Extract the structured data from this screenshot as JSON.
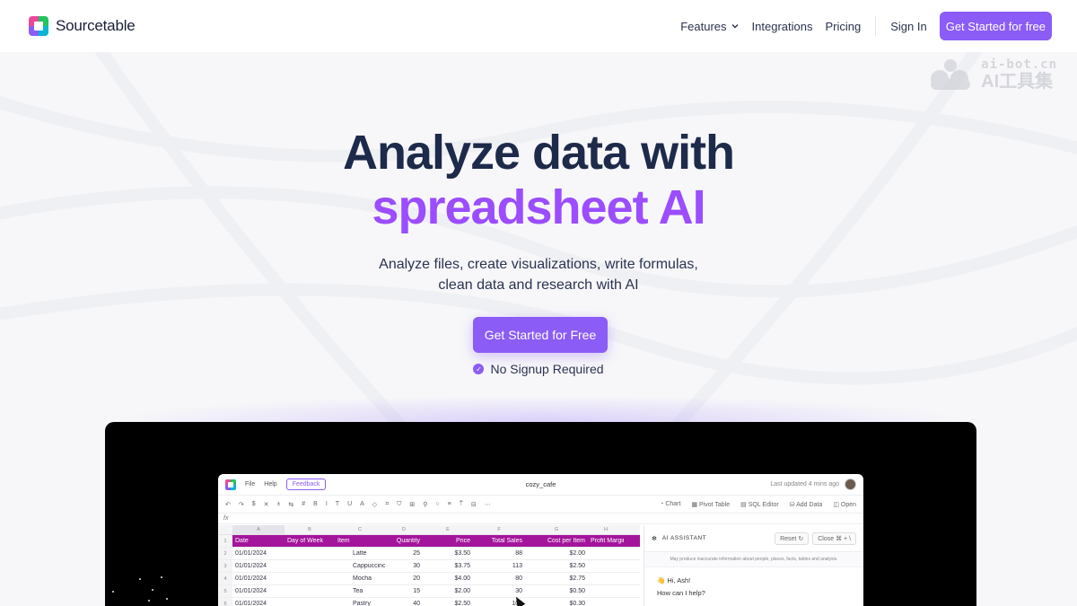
{
  "nav": {
    "brand": "Sourcetable",
    "links": [
      "Features",
      "Integrations",
      "Pricing"
    ],
    "sign_in": "Sign In",
    "cta": "Get Started for free",
    "features_icon": "chevron-down-icon"
  },
  "watermark": {
    "line1": "ai-bot.cn",
    "line2": "AI工具集"
  },
  "hero": {
    "title_line1": "Analyze data with",
    "title_line2": "spreadsheet AI",
    "subtitle_line1": "Analyze files, create visualizations, write formulas,",
    "subtitle_line2": "clean data and research with AI",
    "cta": "Get Started for Free",
    "note": "No Signup Required"
  },
  "colors": {
    "accent": "#8b5cf6",
    "title": "#1d2a4a",
    "gradient_from": "#9b4dff",
    "gradient_to": "#7c3aed",
    "header_row": "#a3159b"
  },
  "app": {
    "menu": [
      "File",
      "Help"
    ],
    "feedback": "Feedback",
    "title": "cozy_cafe",
    "updated": "Last updated 4 mins ago",
    "toolbar_right": [
      "Chart",
      "Pivot Table",
      "SQL Editor",
      "Add Data",
      "Open"
    ],
    "fx": "fx",
    "columns": [
      "A",
      "B",
      "C",
      "D",
      "E",
      "F",
      "G",
      "H"
    ],
    "header": [
      "Date",
      "Day of Week",
      "Item",
      "Quantity",
      "Price",
      "Total Sales",
      "Cost per Item",
      "Profit Margin"
    ],
    "rows": [
      [
        "01/01/2024",
        "",
        "Latte",
        "25",
        "$3.50",
        "88",
        "$2.00",
        ""
      ],
      [
        "01/01/2024",
        "",
        "Cappuccino",
        "30",
        "$3.75",
        "113",
        "$2.50",
        ""
      ],
      [
        "01/01/2024",
        "",
        "Mocha",
        "20",
        "$4.00",
        "80",
        "$2.75",
        ""
      ],
      [
        "01/01/2024",
        "",
        "Tea",
        "15",
        "$2.00",
        "30",
        "$0.50",
        ""
      ],
      [
        "01/01/2024",
        "",
        "Pastry",
        "40",
        "$2.50",
        "100",
        "$0.30",
        ""
      ]
    ],
    "row_numbers": [
      "1",
      "2",
      "3",
      "4",
      "5",
      "6"
    ],
    "ai": {
      "title": "AI ASSISTANT",
      "reset": "Reset",
      "close": "Close",
      "shortcut": "⌘ + \\",
      "note": "May produce inaccurate information about people, places, facts, tables and analysis.",
      "greeting": "👋 Hi, Ash!",
      "question": "How can I help?"
    }
  }
}
